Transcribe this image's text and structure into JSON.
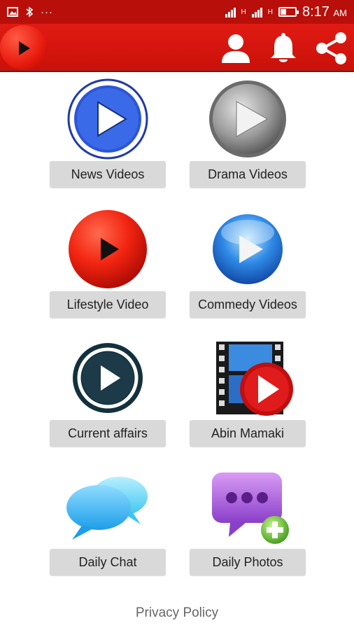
{
  "status_bar": {
    "time": "8:17",
    "ampm": "AM",
    "sim_labels": [
      "H",
      "H"
    ]
  },
  "app_bar": {
    "logo_icon": "play-circle-icon",
    "actions": [
      "profile-icon",
      "bell-icon",
      "share-icon"
    ],
    "brand_color": "#d41510"
  },
  "tiles": [
    {
      "label": "News Videos",
      "icon": "blue-ring-play-icon"
    },
    {
      "label": "Drama Videos",
      "icon": "grey-play-icon"
    },
    {
      "label": "Lifestyle Video",
      "icon": "red-play-icon"
    },
    {
      "label": "Commedy Videos",
      "icon": "blue-glossy-play-icon"
    },
    {
      "label": "Current affairs",
      "icon": "dark-ring-play-icon"
    },
    {
      "label": "Abin Mamaki",
      "icon": "film-play-icon"
    },
    {
      "label": "Daily Chat",
      "icon": "chat-bubbles-icon"
    },
    {
      "label": "Daily Photos",
      "icon": "purple-message-add-icon"
    }
  ],
  "footer": {
    "privacy_label": "Privacy Policy"
  }
}
